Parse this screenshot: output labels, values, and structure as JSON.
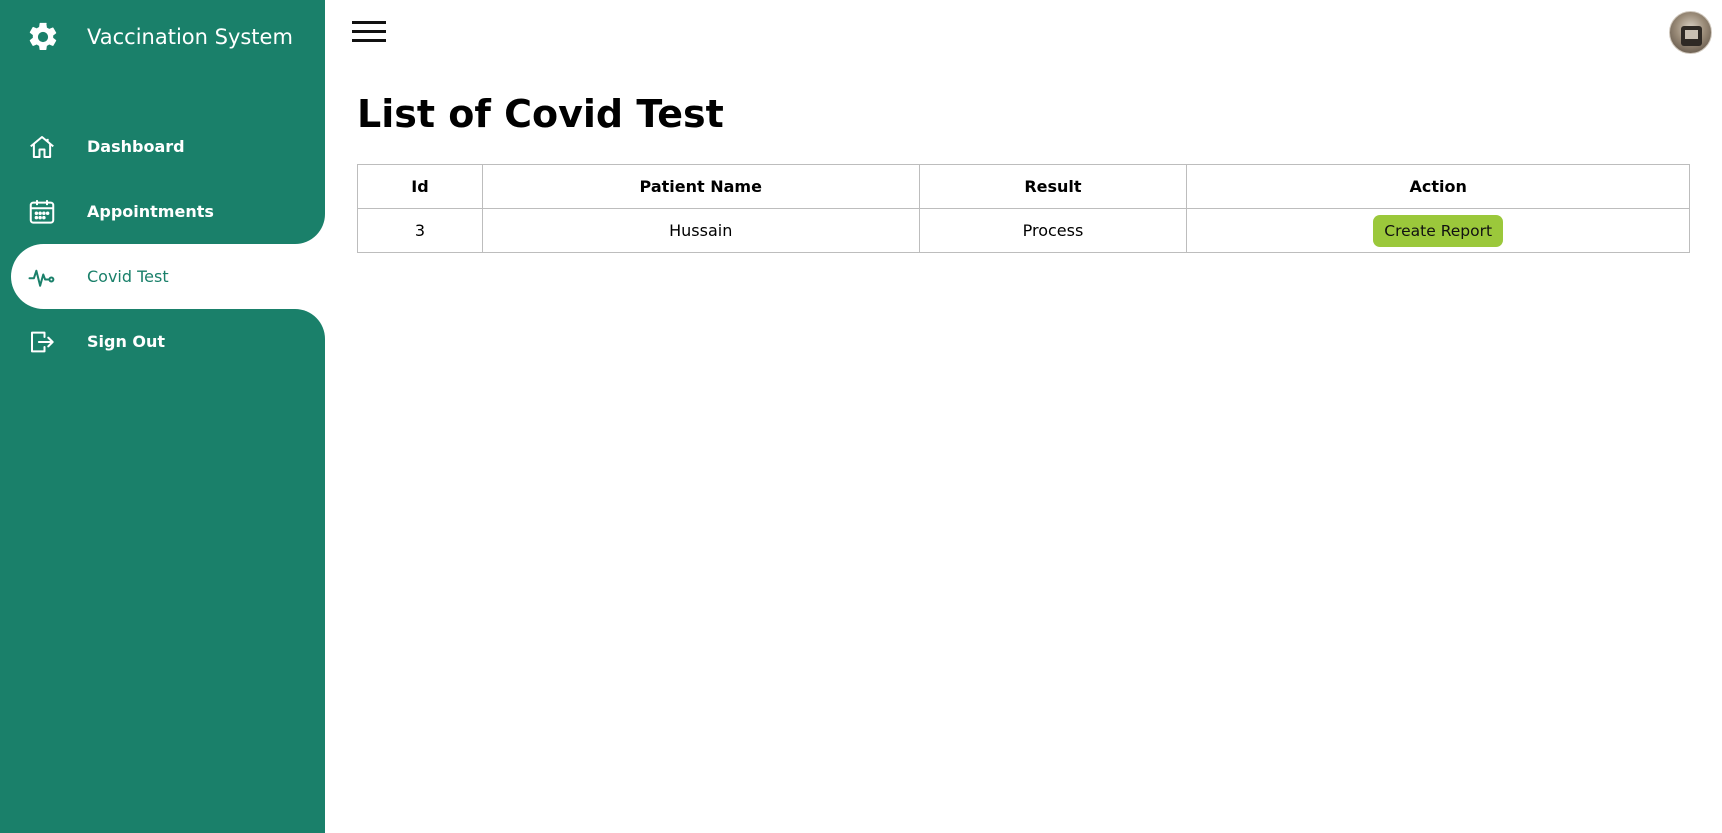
{
  "sidebar": {
    "brand_title": "Vaccination System",
    "brand_icon": "gear-icon",
    "items": [
      {
        "label": "Dashboard",
        "icon": "home-icon"
      },
      {
        "label": "Appointments",
        "icon": "calendar-icon"
      },
      {
        "label": "Covid Test",
        "icon": "pulse-icon",
        "active": true
      },
      {
        "label": "Sign Out",
        "icon": "sign-out-icon"
      }
    ]
  },
  "colors": {
    "sidebar_bg": "#1a806a",
    "active_text": "#1a806a",
    "button_bg": "#9bc83b"
  },
  "main": {
    "title": "List of Covid Test",
    "table": {
      "headers": [
        "Id",
        "Patient Name",
        "Result",
        "Action"
      ],
      "rows": [
        {
          "id": "3",
          "patient_name": "Hussain",
          "result": "Process",
          "action": "Create Report"
        }
      ]
    }
  }
}
